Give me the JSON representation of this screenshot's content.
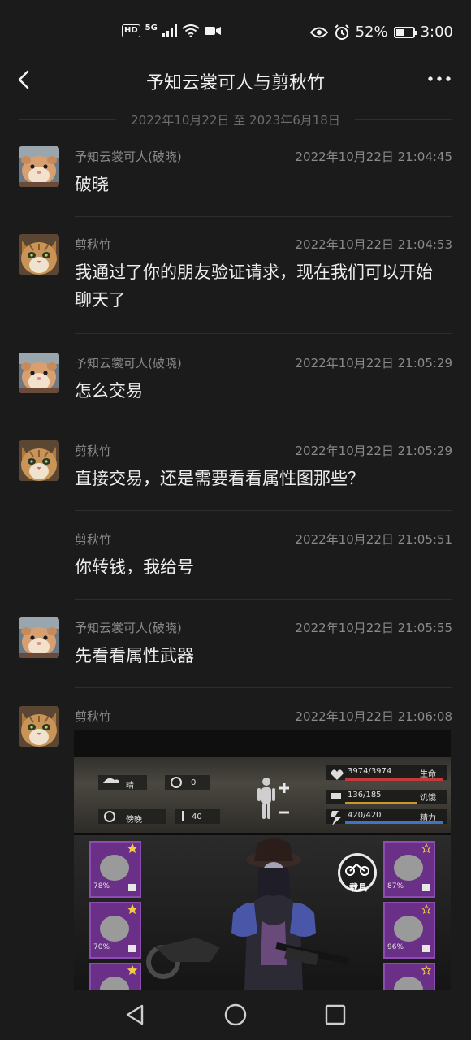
{
  "status_bar": {
    "network_badge": "HD",
    "network_type": "5G",
    "battery_percent": "52%",
    "battery_level": 0.52,
    "time": "3:00"
  },
  "header": {
    "title": "予知云裳可人与剪秋竹",
    "date_range": "2022年10月22日 至 2023年6月18日"
  },
  "messages": [
    {
      "sender": "予知云裳可人(破晓)",
      "time": "2022年10月22日 21:04:45",
      "text": "破晓",
      "avatar": "hamster"
    },
    {
      "sender": "剪秋竹",
      "time": "2022年10月22日 21:04:53",
      "text": "我通过了你的朋友验证请求，现在我们可以开始聊天了",
      "avatar": "cat"
    },
    {
      "sender": "予知云裳可人(破晓)",
      "time": "2022年10月22日 21:05:29",
      "text": "怎么交易",
      "avatar": "hamster"
    },
    {
      "sender": "剪秋竹",
      "time": "2022年10月22日 21:05:29",
      "text": "直接交易，还是需要看看属性图那些？",
      "avatar": "cat"
    },
    {
      "sender": "剪秋竹",
      "time": "2022年10月22日 21:05:51",
      "text": "你转钱，我给号",
      "avatar": "none"
    },
    {
      "sender": "予知云裳可人(破晓)",
      "time": "2022年10月22日 21:05:55",
      "text": "先看看属性武器",
      "avatar": "hamster"
    },
    {
      "sender": "剪秋竹",
      "time": "2022年10月22日 21:06:08",
      "text": "",
      "avatar": "cat"
    }
  ],
  "game_screenshot": {
    "weather": "晴",
    "radiation": "0",
    "time_of_day": "傍晚",
    "temperature": "40",
    "health": "3974/3974",
    "health_label": "生命",
    "hunger": "136/185",
    "hunger_label": "饥饿",
    "energy": "420/420",
    "energy_label": "精力",
    "vehicle_label": "载具",
    "slots_left": [
      "78%",
      "70%",
      ""
    ],
    "slots_right": [
      "87%",
      "96%",
      ""
    ]
  },
  "colors": {
    "background": "#1b1b1b",
    "health_bar": "#c43a3a",
    "hunger_bar": "#c99a2a",
    "energy_bar": "#3f74c4",
    "item_slot": "#6a2f86"
  }
}
